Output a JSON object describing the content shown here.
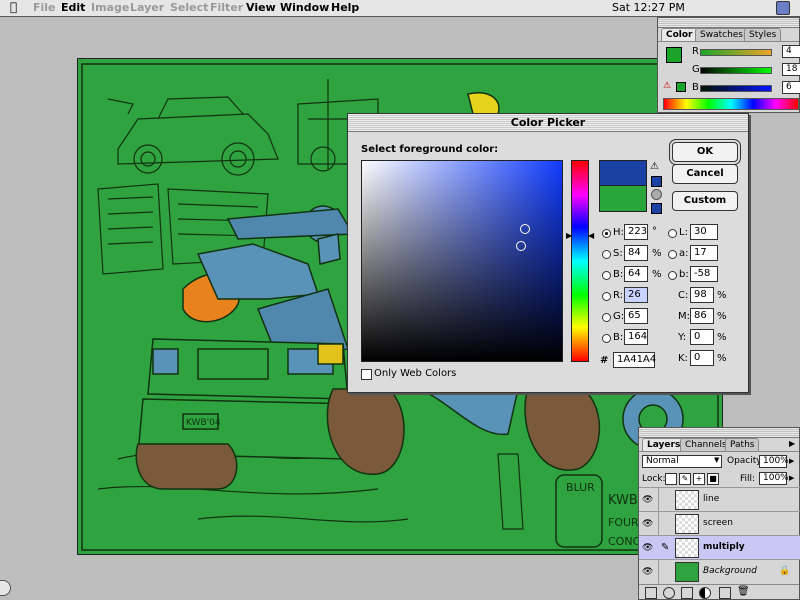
{
  "menubar": {
    "apple_icon": "apple-icon",
    "items": [
      "File",
      "Edit",
      "Image",
      "Layer",
      "Select",
      "Filter",
      "View",
      "Window",
      "Help"
    ],
    "disabled": [
      "File",
      "Image",
      "Layer",
      "Select",
      "Filter"
    ],
    "clock": "Sat 12:27 PM",
    "app_icon": "photoshop-icon"
  },
  "color_palette": {
    "tabs": [
      "Color",
      "Swatches",
      "Styles"
    ],
    "active_tab": "Color",
    "channels": [
      {
        "label": "R",
        "value": "4"
      },
      {
        "label": "G",
        "value": "18"
      },
      {
        "label": "B",
        "value": "6"
      }
    ]
  },
  "color_picker": {
    "title": "Color Picker",
    "prompt": "Select foreground color:",
    "ok_label": "OK",
    "cancel_label": "Cancel",
    "custom_label": "Custom",
    "web_colors_label": "Only Web Colors",
    "hsb": [
      {
        "label": "H:",
        "value": "223",
        "unit": "°"
      },
      {
        "label": "S:",
        "value": "84",
        "unit": "%"
      },
      {
        "label": "B:",
        "value": "64",
        "unit": "%"
      }
    ],
    "rgb": [
      {
        "label": "R:",
        "value": "26"
      },
      {
        "label": "G:",
        "value": "65"
      },
      {
        "label": "B:",
        "value": "164"
      }
    ],
    "lab": [
      {
        "label": "L:",
        "value": "30"
      },
      {
        "label": "a:",
        "value": "17"
      },
      {
        "label": "b:",
        "value": "-58"
      }
    ],
    "cmyk": [
      {
        "label": "C:",
        "value": "98",
        "unit": "%"
      },
      {
        "label": "M:",
        "value": "86",
        "unit": "%"
      },
      {
        "label": "Y:",
        "value": "0",
        "unit": "%"
      },
      {
        "label": "K:",
        "value": "0",
        "unit": "%"
      }
    ],
    "hex_label": "#",
    "hex_value": "1A41A4",
    "new_color": "#1a41a4",
    "old_color": "#2aa53a"
  },
  "layers_palette": {
    "tabs": [
      "Layers",
      "Channels",
      "Paths"
    ],
    "active_tab": "Layers",
    "blend_mode": "Normal",
    "opacity_label": "Opacity:",
    "opacity_value": "100%",
    "lock_label": "Lock:",
    "fill_label": "Fill:",
    "fill_value": "100%",
    "layers": [
      {
        "name": "line",
        "selected": false
      },
      {
        "name": "screen",
        "selected": false
      },
      {
        "name": "multiply",
        "selected": true
      },
      {
        "name": "Background",
        "selected": false
      }
    ]
  },
  "canvas": {
    "background_color": "#2fa33f",
    "sign_text": "KWB'S",
    "sign_text_2": "FOUR-R",
    "sign_text_3": "CONCE",
    "blur_text": "BLUR",
    "plate_text": "KWB'04"
  }
}
